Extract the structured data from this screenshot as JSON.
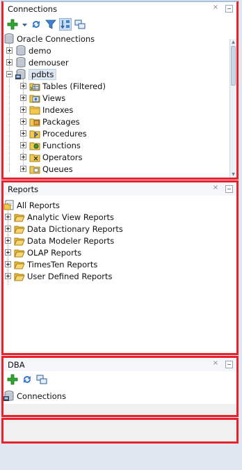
{
  "connections": {
    "title": "Connections",
    "toolbar": [
      "add-connection",
      "dropdown",
      "refresh",
      "filter",
      "schema-browser",
      "manage"
    ],
    "root_label": "Oracle Connections",
    "items": [
      {
        "label": "demo",
        "expanded": false
      },
      {
        "label": "demouser",
        "expanded": false
      },
      {
        "label": "pdbts",
        "expanded": true,
        "selected": true
      }
    ],
    "children": [
      "Tables (Filtered)",
      "Views",
      "Indexes",
      "Packages",
      "Procedures",
      "Functions",
      "Operators",
      "Queues"
    ]
  },
  "reports": {
    "title": "Reports",
    "root_label": "All Reports",
    "items": [
      "Analytic View Reports",
      "Data Dictionary Reports",
      "Data Modeler Reports",
      "OLAP Reports",
      "TimesTen Reports",
      "User Defined Reports"
    ]
  },
  "dba": {
    "title": "DBA",
    "toolbar": [
      "add-connection",
      "refresh",
      "manage"
    ],
    "root_label": "Connections"
  },
  "window": {
    "close_glyph": "×"
  },
  "colors": {
    "highlight_border": "#e8212b",
    "panel_header_accent": "#a8c0e0"
  }
}
